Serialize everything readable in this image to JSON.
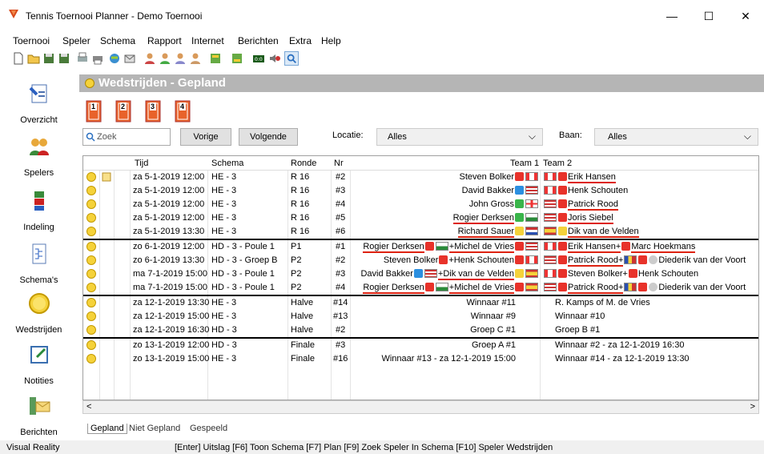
{
  "window": {
    "title": "Tennis Toernooi Planner - Demo Toernooi",
    "minimize": "—",
    "maximize": "☐",
    "close": "✕"
  },
  "menu": [
    "Toernooi",
    "Speler",
    "Schema",
    "Rapport",
    "Internet",
    "Berichten",
    "Extra",
    "Help"
  ],
  "sidebar": [
    {
      "label": "Overzicht",
      "icon": "overview-icon"
    },
    {
      "label": "Spelers",
      "icon": "players-icon"
    },
    {
      "label": "Indeling",
      "icon": "draw-icon"
    },
    {
      "label": "Schema's",
      "icon": "schemes-icon"
    },
    {
      "label": "Wedstrijden",
      "icon": "matches-icon"
    },
    {
      "label": "Notities",
      "icon": "notes-icon"
    },
    {
      "label": "Berichten",
      "icon": "messages-icon"
    }
  ],
  "header": {
    "title": "Wedstrijden - Gepland"
  },
  "courts": [
    "1",
    "2",
    "3",
    "4"
  ],
  "filter": {
    "search_placeholder": "Zoek",
    "prev": "Vorige",
    "next": "Volgende",
    "location_label": "Locatie:",
    "location_value": "Alles",
    "court_label": "Baan:",
    "court_value": "Alles"
  },
  "columns": {
    "time": "Tijd",
    "schema": "Schema",
    "round": "Ronde",
    "nr": "Nr",
    "team1": "Team 1",
    "team2": "Team 2"
  },
  "rows": [
    {
      "time": "za 5-1-2019 12:00",
      "schema": "HE - 3",
      "round": "R 16",
      "nr": "#2",
      "team1": "Steven Bolker",
      "team2": "Erik Hansen"
    },
    {
      "time": "za 5-1-2019 12:00",
      "schema": "HE - 3",
      "round": "R 16",
      "nr": "#3",
      "team1": "David Bakker",
      "team2": "Henk Schouten"
    },
    {
      "time": "za 5-1-2019 12:00",
      "schema": "HE - 3",
      "round": "R 16",
      "nr": "#4",
      "team1": "John Gross",
      "team2": "Patrick Rood"
    },
    {
      "time": "za 5-1-2019 12:00",
      "schema": "HE - 3",
      "round": "R 16",
      "nr": "#5",
      "team1": "Rogier Derksen",
      "team2": "Joris Siebel"
    },
    {
      "time": "za 5-1-2019 13:30",
      "schema": "HE - 3",
      "round": "R 16",
      "nr": "#6",
      "team1": "Richard Sauer",
      "team2": "Dik van de Velden"
    },
    {
      "time": "zo 6-1-2019 12:00",
      "schema": "HD - 3 - Poule 1",
      "round": "P1",
      "nr": "#1",
      "team1a": "Rogier Derksen",
      "team1b": "+Michel de Vries",
      "team2a": "Erik Hansen+",
      "team2b": "Marc Hoekmans"
    },
    {
      "time": "zo 6-1-2019 13:30",
      "schema": "HD - 3 - Groep B",
      "round": "P2",
      "nr": "#2",
      "team1a": "Steven Bolker",
      "team1b": "+Henk Schouten",
      "team2a": "Patrick Rood+",
      "team2b": "Diederik van der Voort"
    },
    {
      "time": "ma 7-1-2019 15:00",
      "schema": "HD - 3 - Poule 1",
      "round": "P2",
      "nr": "#3",
      "team1a": "David Bakker",
      "team1b": "+Dik van de Velden",
      "team2a": "Steven Bolker+",
      "team2b": "Henk Schouten"
    },
    {
      "time": "ma 7-1-2019 15:00",
      "schema": "HD - 3 - Poule 1",
      "round": "P2",
      "nr": "#4",
      "team1a": "Rogier Derksen",
      "team1b": "+Michel de Vries",
      "team2a": "Patrick Rood+",
      "team2b": "Diederik van der Voort"
    },
    {
      "time": "za 12-1-2019 13:30",
      "schema": "HE - 3",
      "round": "Halve",
      "nr": "#14",
      "team1": "Winnaar #11",
      "team2": "R. Kamps of M. de Vries"
    },
    {
      "time": "za 12-1-2019 15:00",
      "schema": "HE - 3",
      "round": "Halve",
      "nr": "#13",
      "team1": "Winnaar #9",
      "team2": "Winnaar #10"
    },
    {
      "time": "za 12-1-2019 16:30",
      "schema": "HD - 3",
      "round": "Halve",
      "nr": "#2",
      "team1": "Groep C #1",
      "team2": "Groep B #1"
    },
    {
      "time": "zo 13-1-2019 12:00",
      "schema": "HD - 3",
      "round": "Finale",
      "nr": "#3",
      "team1": "Groep A #1",
      "team2": "Winnaar #2 - za 12-1-2019 16:30"
    },
    {
      "time": "zo 13-1-2019 15:00",
      "schema": "HE - 3",
      "round": "Finale",
      "nr": "#16",
      "team1": "Winnaar #13 - za 12-1-2019 15:00",
      "team2": "Winnaar #14 - za 12-1-2019 13:30"
    }
  ],
  "tabs": [
    "Gepland",
    "Niet Gepland",
    "Gespeeld"
  ],
  "status": {
    "company": "Visual Reality",
    "keys": "[Enter] Uitslag [F6] Toon Schema [F7] Plan [F9] Zoek Speler In Schema [F10] Speler Wedstrijden"
  },
  "scroll": {
    "left": "<",
    "right": ">"
  },
  "colors": {
    "accent": "#f5d23a",
    "header": "#b5b5b5",
    "red": "#e8322a",
    "blue": "#2b8fe0",
    "green": "#39b54a"
  }
}
